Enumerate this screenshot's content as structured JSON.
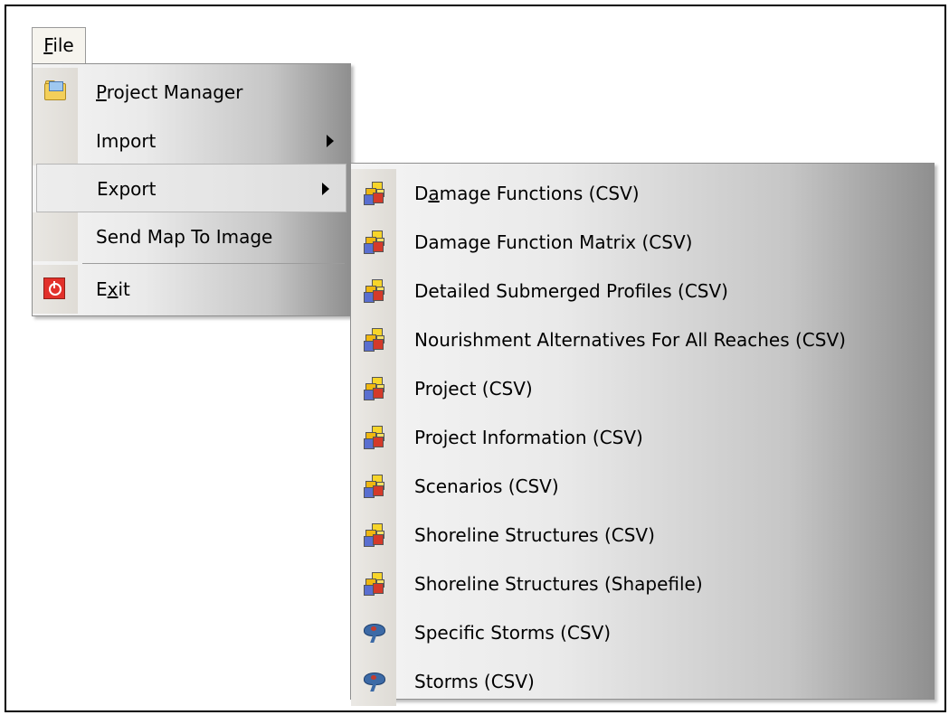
{
  "menubar": {
    "file_label": "File",
    "file_mnemonic": "F",
    "file_rest": "ile"
  },
  "file_menu": {
    "items": [
      {
        "mnemonic": "P",
        "rest": "roject Manager",
        "icon": "project-folder-icon",
        "submenu": false
      },
      {
        "label": "Import",
        "submenu": true
      },
      {
        "label": "Export",
        "submenu": true,
        "highlighted": true
      },
      {
        "label": "Send Map To  Image",
        "submenu": false
      },
      {
        "pre": "E",
        "mnemonic": "x",
        "rest": "it",
        "icon": "exit-icon",
        "submenu": false
      }
    ]
  },
  "export_menu": {
    "items": [
      {
        "pre": "D",
        "mnemonic": "a",
        "rest": "mage Functions (CSV)",
        "icon": "cubes-icon"
      },
      {
        "label": "Damage Function Matrix (CSV)",
        "icon": "cubes-icon"
      },
      {
        "label": "Detailed Submerged Profiles (CSV)",
        "icon": "cubes-icon"
      },
      {
        "label": "Nourishment Alternatives For All Reaches (CSV)",
        "icon": "cubes-icon"
      },
      {
        "label": "Project (CSV)",
        "icon": "cubes-icon"
      },
      {
        "label": "Project Information (CSV)",
        "icon": "cubes-icon"
      },
      {
        "label": "Scenarios (CSV)",
        "icon": "cubes-icon"
      },
      {
        "label": "Shoreline Structures (CSV)",
        "icon": "cubes-icon"
      },
      {
        "label": "Shoreline Structures (Shapefile)",
        "icon": "cubes-icon"
      },
      {
        "label": "Specific Storms (CSV)",
        "icon": "storm-icon"
      },
      {
        "label": "Storms (CSV)",
        "icon": "storm-icon"
      }
    ]
  }
}
